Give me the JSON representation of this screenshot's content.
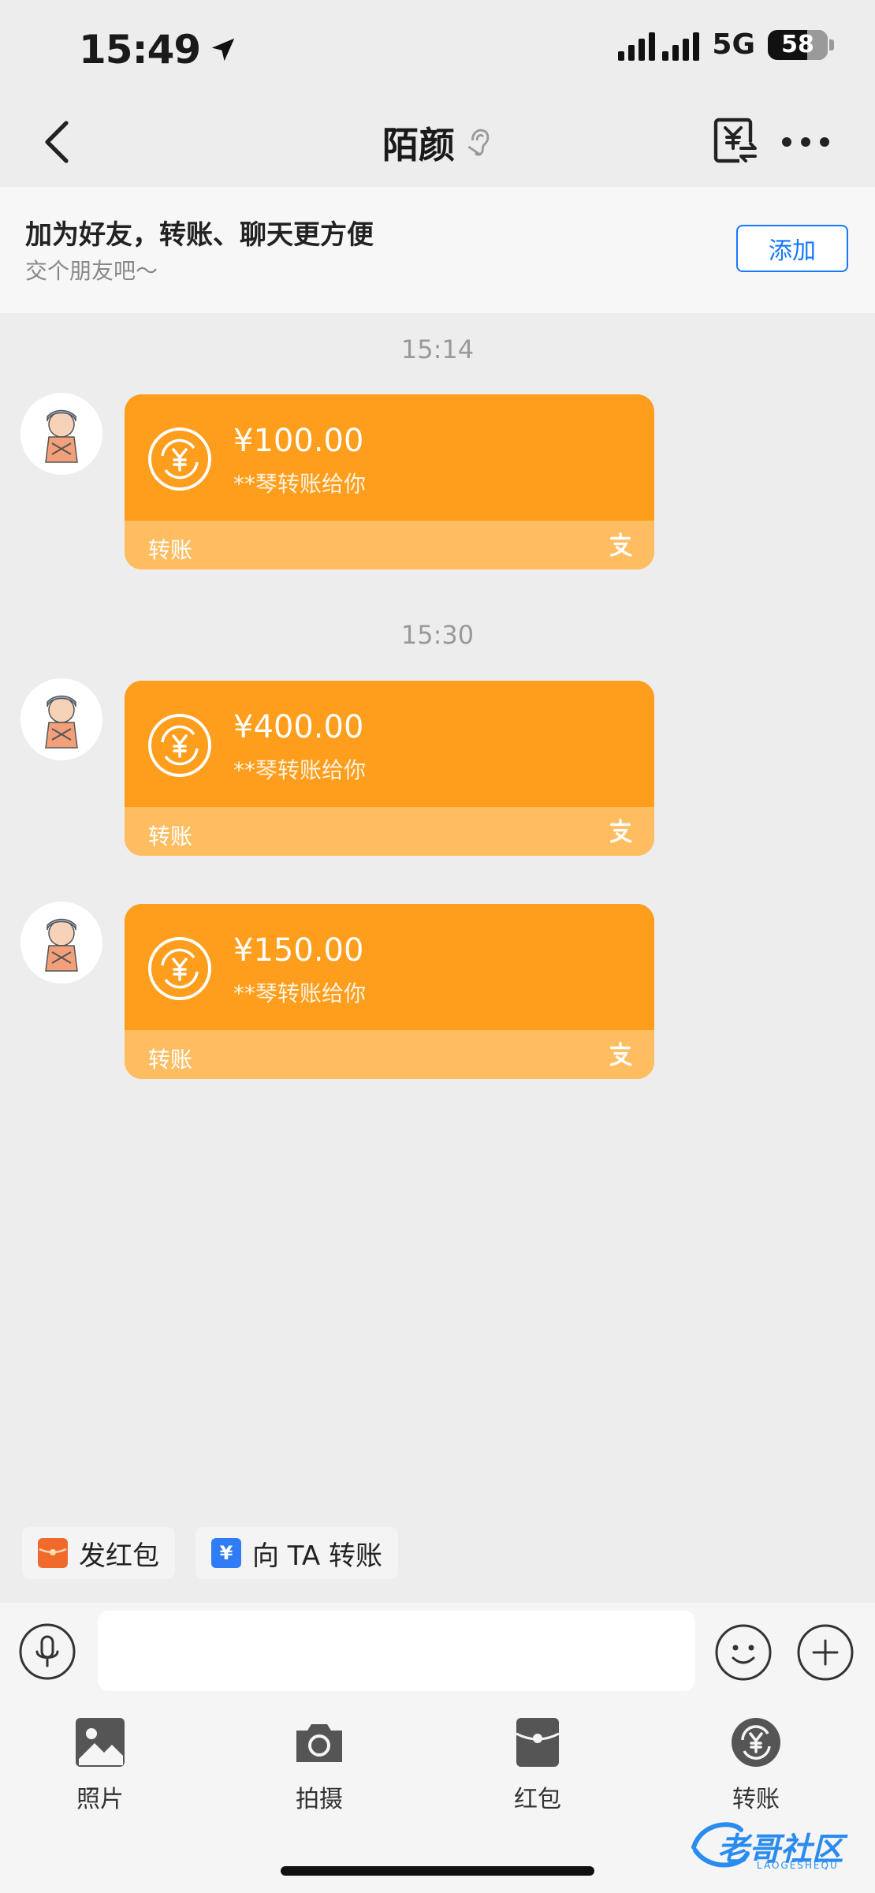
{
  "status_bar": {
    "time": "15:49",
    "network": "5G",
    "battery": "58"
  },
  "nav": {
    "title": "陌颜"
  },
  "banner": {
    "title": "加为好友，转账、聊天更方便",
    "subtitle": "交个朋友吧～",
    "add_label": "添加"
  },
  "messages": [
    {
      "timestamp": "15:14",
      "amount": "¥100.00",
      "desc": "**琴转账给你",
      "label": "转账"
    },
    {
      "timestamp": "15:30",
      "amount": "¥400.00",
      "desc": "**琴转账给你",
      "label": "转账"
    },
    {
      "timestamp": "",
      "amount": "¥150.00",
      "desc": "**琴转账给你",
      "label": "转账"
    }
  ],
  "quick_actions": {
    "red_packet": "发红包",
    "transfer_to": "向 TA 转账"
  },
  "input": {
    "placeholder": ""
  },
  "panel": [
    {
      "label": "照片",
      "icon": "photo-icon"
    },
    {
      "label": "拍摄",
      "icon": "camera-icon"
    },
    {
      "label": "红包",
      "icon": "red-packet-icon"
    },
    {
      "label": "转账",
      "icon": "transfer-icon"
    }
  ],
  "watermark": {
    "text": "老哥社区",
    "sub": "LAOGESHEQU"
  },
  "colors": {
    "card": "#ff9d1c",
    "card_bottom": "#ffbd62",
    "accent_blue": "#1677ff",
    "background": "#ededed"
  }
}
